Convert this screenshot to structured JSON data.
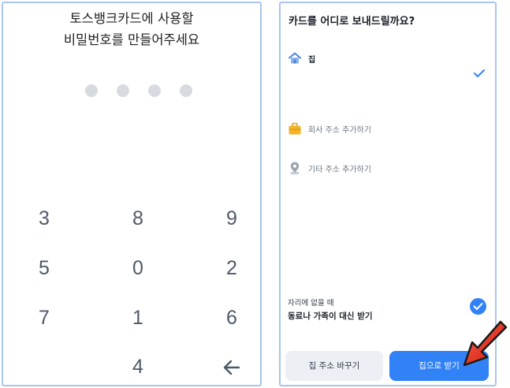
{
  "pin_screen": {
    "title_line1": "토스뱅크카드에 사용할",
    "title_line2": "비밀번호를 만들어주세요",
    "dots_count": 4,
    "keys": [
      "3",
      "8",
      "9",
      "5",
      "0",
      "2",
      "7",
      "1",
      "6",
      "",
      "4",
      "backspace"
    ]
  },
  "delivery_screen": {
    "title": "카드를 어디로 보내드릴까요?",
    "options": {
      "home": {
        "label": "집",
        "icon": "home-icon",
        "selected": true
      },
      "work": {
        "label": "회사 주소 추가하기",
        "icon": "briefcase-icon"
      },
      "other": {
        "label": "기타 주소 추가하기",
        "icon": "location-pin-icon"
      }
    },
    "alt_receiver": {
      "caption": "자리에 없을 때",
      "label": "동료나 가족이 대신 받기",
      "checked": true
    },
    "buttons": {
      "change_address": "집 주소 바꾸기",
      "receive_home": "집으로 받기"
    }
  },
  "colors": {
    "accent": "#3182f6",
    "panel_border": "#a9c4ee",
    "dot": "#d7dbe0",
    "key_text": "#4e5968",
    "arrow": "#e8231c"
  }
}
